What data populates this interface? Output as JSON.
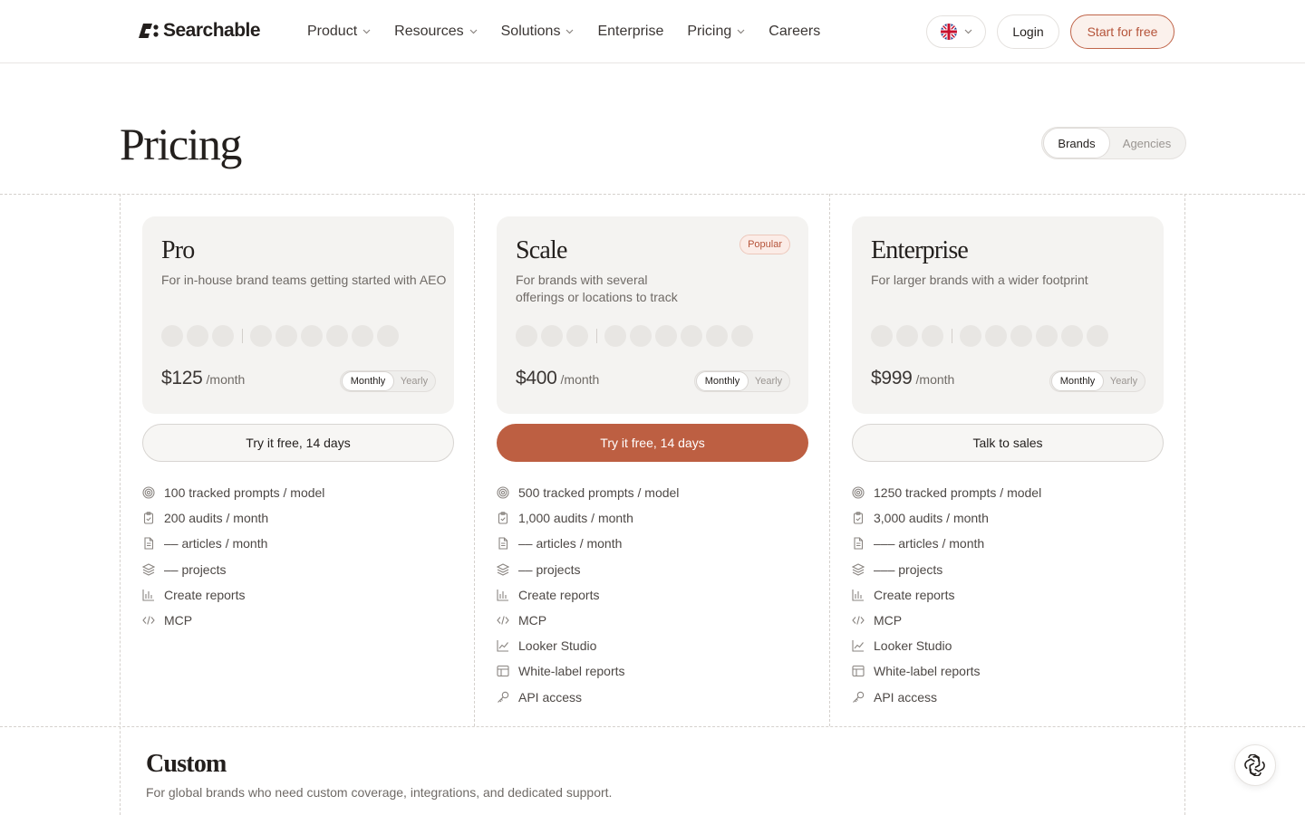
{
  "header": {
    "logo_text": "Searchable",
    "nav": [
      {
        "label": "Product",
        "dropdown": true
      },
      {
        "label": "Resources",
        "dropdown": true
      },
      {
        "label": "Solutions",
        "dropdown": true
      },
      {
        "label": "Enterprise",
        "dropdown": false
      },
      {
        "label": "Pricing",
        "dropdown": true
      },
      {
        "label": "Careers",
        "dropdown": false
      }
    ],
    "login_label": "Login",
    "start_label": "Start for free"
  },
  "page": {
    "title": "Pricing",
    "audience": {
      "selected": "Brands",
      "other": "Agencies"
    }
  },
  "plans": [
    {
      "name": "Pro",
      "desc": "For in-house brand teams getting started with AEO",
      "badge": "",
      "price": "$125",
      "per": "/month",
      "period_active": "Monthly",
      "period_other": "Yearly",
      "cta": "Try it free, 14 days",
      "features": [
        {
          "icon": "target-icon",
          "text": "100 tracked prompts / model"
        },
        {
          "icon": "clipboard-check-icon",
          "text": "200 audits / month"
        },
        {
          "icon": "document-icon",
          "text": "–– articles / month"
        },
        {
          "icon": "layers-icon",
          "text": "–– projects"
        },
        {
          "icon": "bar-chart-icon",
          "text": "Create reports"
        },
        {
          "icon": "code-icon",
          "text": "MCP"
        }
      ]
    },
    {
      "name": "Scale",
      "desc_lines": [
        "For brands with several",
        "offerings or locations to track"
      ],
      "badge": "Popular",
      "price": "$400",
      "per": "/month",
      "period_active": "Monthly",
      "period_other": "Yearly",
      "cta": "Try it free, 14 days",
      "features": [
        {
          "icon": "target-icon",
          "text": "500 tracked prompts / model"
        },
        {
          "icon": "clipboard-check-icon",
          "text": "1,000 audits / month"
        },
        {
          "icon": "document-icon",
          "text": "–– articles / month"
        },
        {
          "icon": "layers-icon",
          "text": "–– projects"
        },
        {
          "icon": "bar-chart-icon",
          "text": "Create reports"
        },
        {
          "icon": "code-icon",
          "text": "MCP"
        },
        {
          "icon": "line-chart-icon",
          "text": "Looker Studio"
        },
        {
          "icon": "layout-icon",
          "text": "White-label reports"
        },
        {
          "icon": "key-icon",
          "text": "API access"
        }
      ]
    },
    {
      "name": "Enterprise",
      "desc": "For larger brands with a wider footprint",
      "badge": "",
      "price": "$999",
      "per": "/month",
      "period_active": "Monthly",
      "period_other": "Yearly",
      "cta": "Talk to sales",
      "features": [
        {
          "icon": "target-icon",
          "text": "1250 tracked prompts / model"
        },
        {
          "icon": "clipboard-check-icon",
          "text": "3,000 audits / month"
        },
        {
          "icon": "document-icon",
          "text": "––– articles / month"
        },
        {
          "icon": "layers-icon",
          "text": "––– projects"
        },
        {
          "icon": "bar-chart-icon",
          "text": "Create reports"
        },
        {
          "icon": "code-icon",
          "text": "MCP"
        },
        {
          "icon": "line-chart-icon",
          "text": "Looker Studio"
        },
        {
          "icon": "layout-icon",
          "text": "White-label reports"
        },
        {
          "icon": "key-icon",
          "text": "API access"
        }
      ]
    }
  ],
  "custom": {
    "title": "Custom",
    "desc": "For global brands who need custom coverage, integrations, and dedicated support."
  },
  "colors": {
    "accent": "#bd5f42",
    "accent_text": "#b5543a",
    "card_bg": "#f4f3f1"
  }
}
